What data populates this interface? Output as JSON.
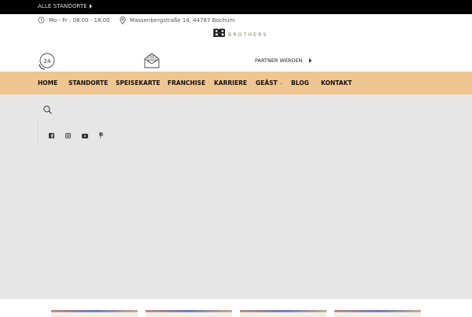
{
  "topbar": {
    "locations_label": "ALLE STANDORTE"
  },
  "contact": {
    "hours": "Mo - Fr : 08.00 - 18.00",
    "address": "Massenbergstraße 14, 44787 Bochum"
  },
  "logo": {
    "mark": "BB",
    "word": "BROTHERS"
  },
  "phone_badge": "24",
  "partner": {
    "label": "PARTNER WERDEN"
  },
  "nav": {
    "items": [
      "HOME",
      "STANDORTE",
      "SPEISEKARTE",
      "FRANCHISE",
      "KARRIERE",
      "GEÄST",
      "BLOG",
      "KONTAKT"
    ]
  },
  "social_icons": [
    "facebook-icon",
    "instagram-icon",
    "youtube-icon",
    "pinterest-icon"
  ],
  "colors": {
    "nav_bg": "#efc591",
    "topbar_bg": "#000000",
    "main_bg": "#e6e6e6"
  }
}
